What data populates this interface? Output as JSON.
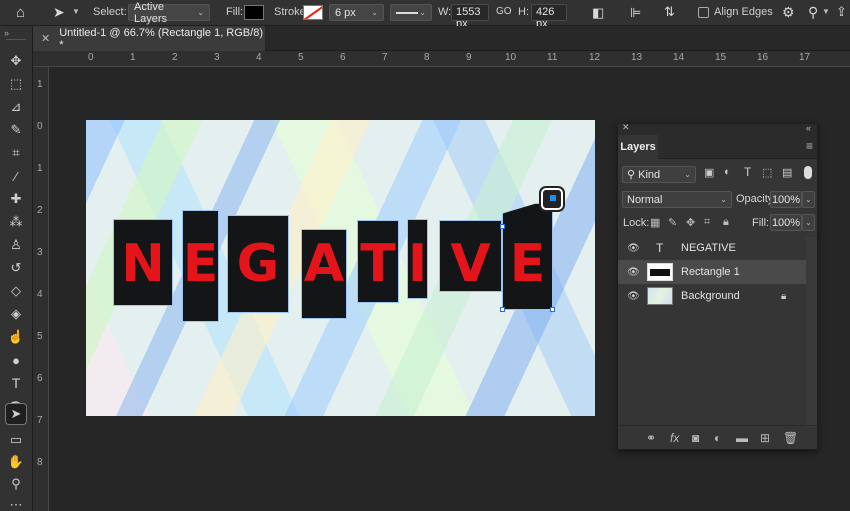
{
  "options_bar": {
    "select_label": "Select:",
    "select_value": "Active Layers",
    "fill_label": "Fill:",
    "stroke_label": "Stroke:",
    "stroke_width": "6 px",
    "w_label": "W:",
    "w_value": "1553 px",
    "link_label": "GO",
    "h_label": "H:",
    "h_value": "426 px",
    "align_edges_label": "Align Edges",
    "fill_color": "#000000"
  },
  "document": {
    "tab_title": "Untitled-1 @ 66.7% (Rectangle 1, RGB/8) *"
  },
  "rulers": {
    "top": [
      "0",
      "1",
      "2",
      "3",
      "4",
      "5",
      "6",
      "7",
      "8",
      "9",
      "10",
      "11",
      "12",
      "13",
      "14",
      "15",
      "16",
      "17"
    ],
    "left": [
      "1",
      "0",
      "1",
      "2",
      "3",
      "4",
      "5",
      "6",
      "7",
      "8"
    ]
  },
  "canvas": {
    "letters": [
      "N",
      "E",
      "G",
      "A",
      "T",
      "I",
      "V",
      "E"
    ],
    "letter_color": "#e4141b",
    "box_color": "#141516"
  },
  "layers_panel": {
    "title": "Layers",
    "filter_kind": "Kind",
    "blend_mode": "Normal",
    "opacity_label": "Opacity:",
    "opacity_value": "100%",
    "lock_label": "Lock:",
    "fill_label": "Fill:",
    "fill_value": "100%",
    "layers": [
      {
        "name": "NEGATIVE",
        "type": "text"
      },
      {
        "name": "Rectangle 1",
        "type": "shape",
        "selected": true
      },
      {
        "name": "Background",
        "type": "image",
        "locked": true
      }
    ]
  }
}
